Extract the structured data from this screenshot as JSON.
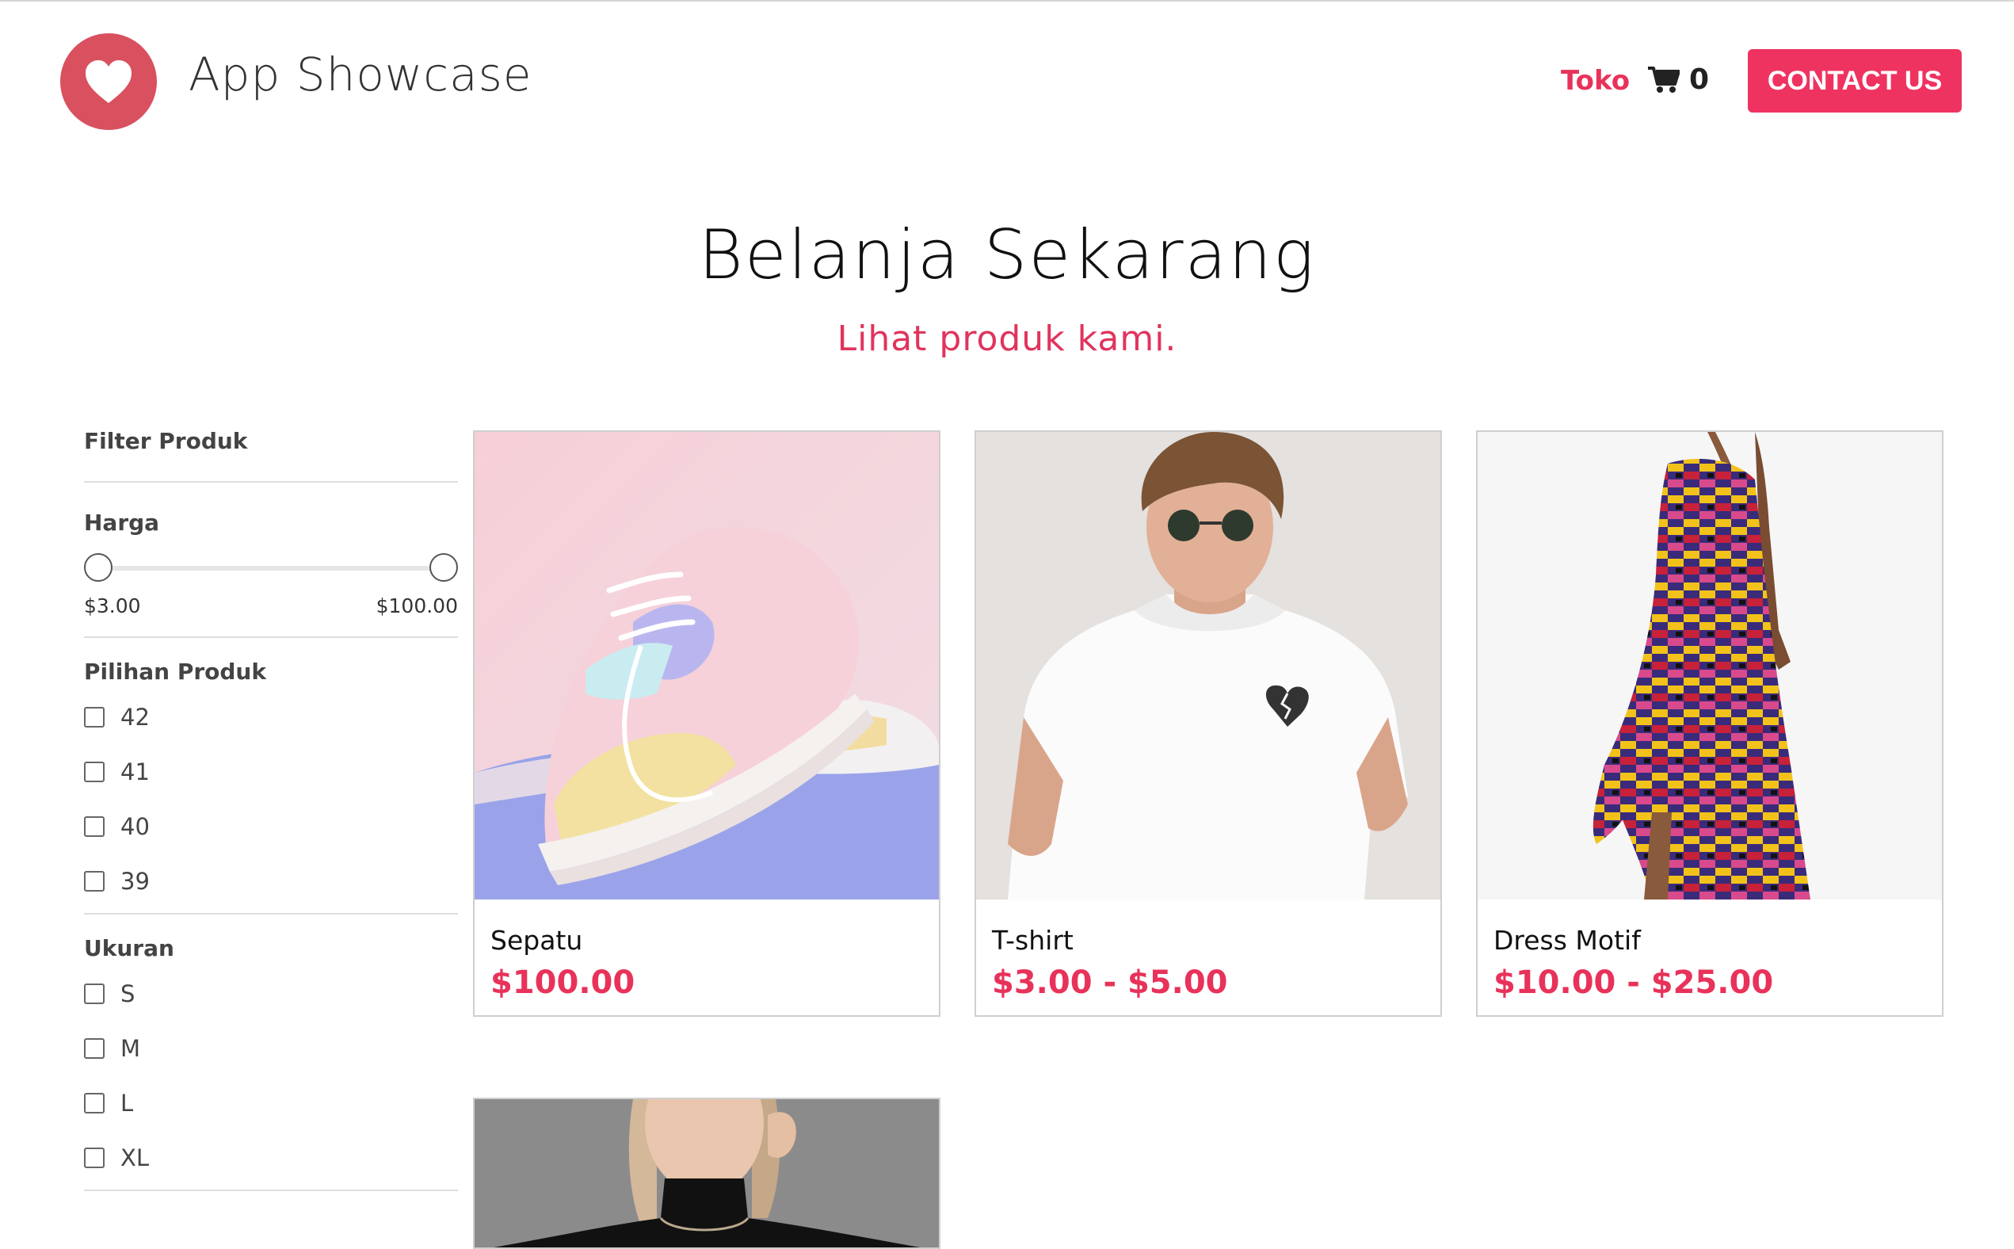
{
  "header": {
    "app_title": "App Showcase",
    "nav_shop": "Toko",
    "cart_count": "0",
    "contact_label": "CONTACT US",
    "accent_color": "#ef3360",
    "logo_color": "#d9505f"
  },
  "hero": {
    "title": "Belanja Sekarang",
    "subtitle": "Lihat produk kami."
  },
  "sidebar": {
    "heading": "Filter Produk",
    "price": {
      "label": "Harga",
      "min": "$3.00",
      "max": "$100.00"
    },
    "product_options": {
      "label": "Pilihan Produk",
      "items": [
        "42",
        "41",
        "40",
        "39"
      ]
    },
    "sizes": {
      "label": "Ukuran",
      "items": [
        "S",
        "M",
        "L",
        "XL"
      ]
    }
  },
  "products": [
    {
      "name": "Sepatu",
      "price": "$100.00",
      "image": "sneaker-photo"
    },
    {
      "name": "T-shirt",
      "price": "$3.00 - $5.00",
      "image": "tshirt-photo"
    },
    {
      "name": "Dress Motif",
      "price": "$10.00 - $25.00",
      "image": "dress-photo"
    },
    {
      "name": "",
      "price": "",
      "image": "turtleneck-photo"
    }
  ]
}
